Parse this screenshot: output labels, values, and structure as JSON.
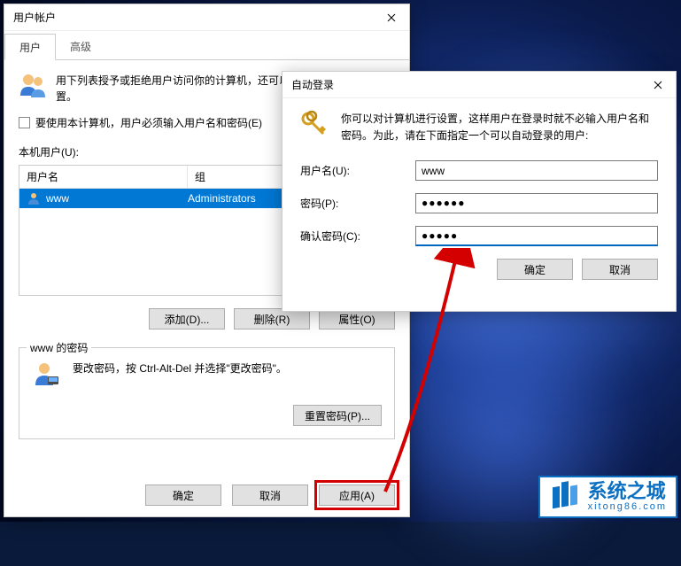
{
  "ua": {
    "title": "用户帐户",
    "tabs": {
      "users": "用户",
      "advanced": "高级"
    },
    "intro": "用下列表授予或拒绝用户访问你的计算机，还可以更改其密码和其他设置。",
    "checkbox_label": "要使用本计算机，用户必须输入用户名和密码(E)",
    "list_label": "本机用户(U):",
    "cols": {
      "name": "用户名",
      "group": "组"
    },
    "row": {
      "name": "www",
      "group": "Administrators"
    },
    "buttons": {
      "add": "添加(D)...",
      "delete": "删除(R)",
      "props": "属性(O)",
      "reset_pw": "重置密码(P)..."
    },
    "pw_group_title": "www 的密码",
    "pw_hint": "要改密码，按 Ctrl-Alt-Del 并选择\"更改密码\"。",
    "dlg": {
      "ok": "确定",
      "cancel": "取消",
      "apply": "应用(A)"
    }
  },
  "al": {
    "title": "自动登录",
    "intro": "你可以对计算机进行设置，这样用户在登录时就不必输入用户名和密码。为此，请在下面指定一个可以自动登录的用户:",
    "labels": {
      "user": "用户名(U):",
      "pw": "密码(P):",
      "cpw": "确认密码(C):"
    },
    "values": {
      "user": "www",
      "pw": "●●●●●●",
      "cpw": "●●●●●"
    },
    "buttons": {
      "ok": "确定",
      "cancel": "取消"
    }
  },
  "watermark": {
    "cn": "系统之城",
    "en": "xitong86.com"
  }
}
